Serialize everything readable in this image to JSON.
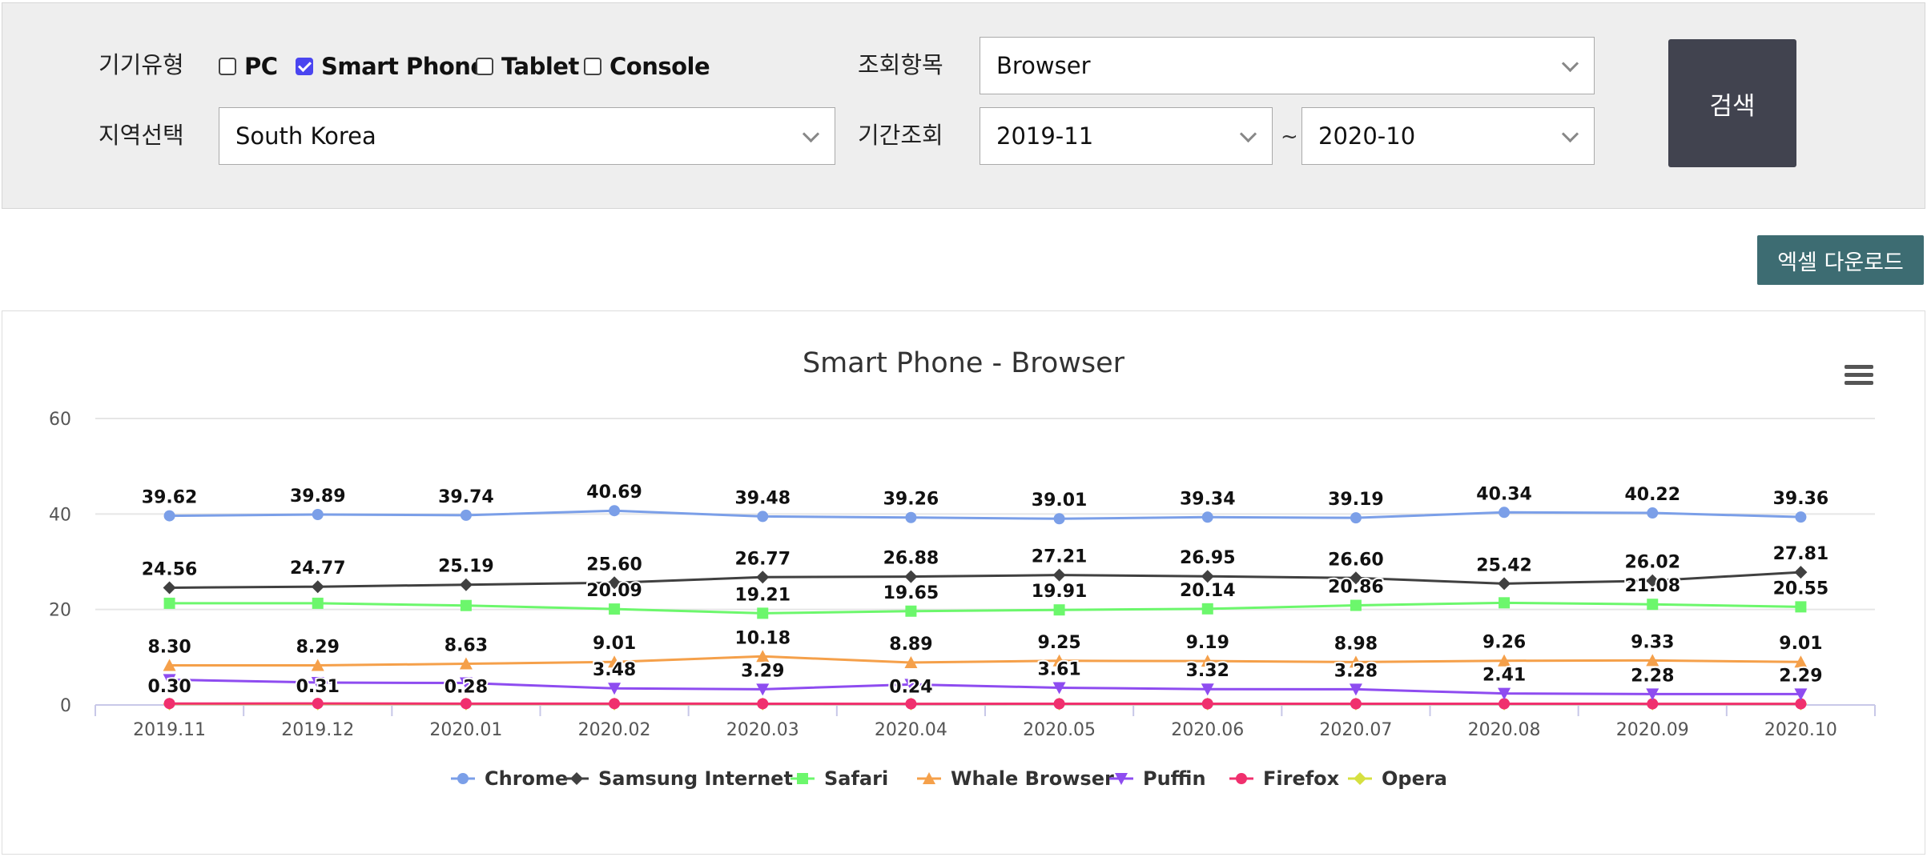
{
  "filters": {
    "device_label": "기기유형",
    "device_options": [
      {
        "label": "PC",
        "checked": false
      },
      {
        "label": "Smart Phone",
        "checked": true
      },
      {
        "label": "Tablet",
        "checked": false
      },
      {
        "label": "Console",
        "checked": false
      }
    ],
    "region_label": "지역선택",
    "region_value": "South Korea",
    "item_label": "조회항목",
    "item_value": "Browser",
    "period_label": "기간조회",
    "period_start": "2019-11",
    "period_separator": "~",
    "period_end": "2020-10",
    "search_label": "검색"
  },
  "excel_label": "엑셀 다운로드",
  "colors": {
    "accent": "#4a45f0",
    "search_button": "#41434f",
    "excel_button": "#3d6c72"
  },
  "chart_data": {
    "type": "line",
    "title": "Smart Phone - Browser",
    "xlabel": "",
    "ylabel": "",
    "ylim": [
      0,
      60
    ],
    "yticks": [
      0,
      20,
      40,
      60
    ],
    "grid": true,
    "legend_position": "bottom",
    "menu_icon": "hamburger-icon",
    "categories": [
      "2019.11",
      "2019.12",
      "2020.01",
      "2020.02",
      "2020.03",
      "2020.04",
      "2020.05",
      "2020.06",
      "2020.07",
      "2020.08",
      "2020.09",
      "2020.10"
    ],
    "series": [
      {
        "name": "Chrome",
        "color": "#7b9fe8",
        "marker": "circle",
        "labels": true,
        "values": [
          39.62,
          39.89,
          39.74,
          40.69,
          39.48,
          39.26,
          39.01,
          39.34,
          39.19,
          40.34,
          40.22,
          39.36
        ]
      },
      {
        "name": "Samsung Internet",
        "color": "#404040",
        "marker": "diamond",
        "labels": true,
        "values": [
          24.56,
          24.77,
          25.19,
          25.6,
          26.77,
          26.88,
          27.21,
          26.95,
          26.6,
          25.42,
          26.02,
          27.81
        ]
      },
      {
        "name": "Safari",
        "color": "#6cf76c",
        "marker": "square",
        "labels": true,
        "values": [
          21.3,
          21.3,
          20.83,
          20.09,
          19.21,
          19.65,
          19.91,
          20.14,
          20.86,
          21.4,
          21.08,
          20.55
        ],
        "shown_labels": [
          "",
          "",
          "",
          "20.09",
          "19.21",
          "19.65",
          "19.91",
          "20.14",
          "20.86",
          "",
          "21.08",
          "20.55"
        ]
      },
      {
        "name": "Whale Browser",
        "color": "#f5a04a",
        "marker": "triangle",
        "labels": true,
        "values": [
          8.3,
          8.29,
          8.63,
          9.01,
          10.18,
          8.89,
          9.25,
          9.19,
          8.98,
          9.26,
          9.33,
          9.01
        ]
      },
      {
        "name": "Puffin",
        "color": "#8e4cf0",
        "marker": "triangle-down",
        "labels": false,
        "values": [
          5.3,
          4.7,
          4.6,
          3.48,
          3.29,
          4.3,
          3.61,
          3.32,
          3.28,
          2.41,
          2.28,
          2.29
        ],
        "shown_labels": [
          "",
          "",
          "",
          "3.48",
          "3.29",
          "",
          "3.61",
          "3.32",
          "3.28",
          "2.41",
          "2.28",
          "2.29"
        ]
      },
      {
        "name": "Firefox",
        "color": "#f0306e",
        "marker": "circle",
        "labels": false,
        "values": [
          0.3,
          0.31,
          0.28,
          0.28,
          0.26,
          0.24,
          0.25,
          0.25,
          0.25,
          0.25,
          0.24,
          0.24
        ],
        "shown_labels": [
          "0.30",
          "0.31",
          "0.28",
          "",
          "",
          "0.24",
          "",
          "",
          "",
          "",
          "",
          ""
        ]
      },
      {
        "name": "Opera",
        "color": "#d6e040",
        "marker": "diamond",
        "labels": false,
        "values": [
          0.2,
          0.2,
          0.2,
          0.2,
          0.2,
          0.2,
          0.2,
          0.2,
          0.2,
          0.2,
          0.2,
          0.2
        ]
      }
    ]
  }
}
